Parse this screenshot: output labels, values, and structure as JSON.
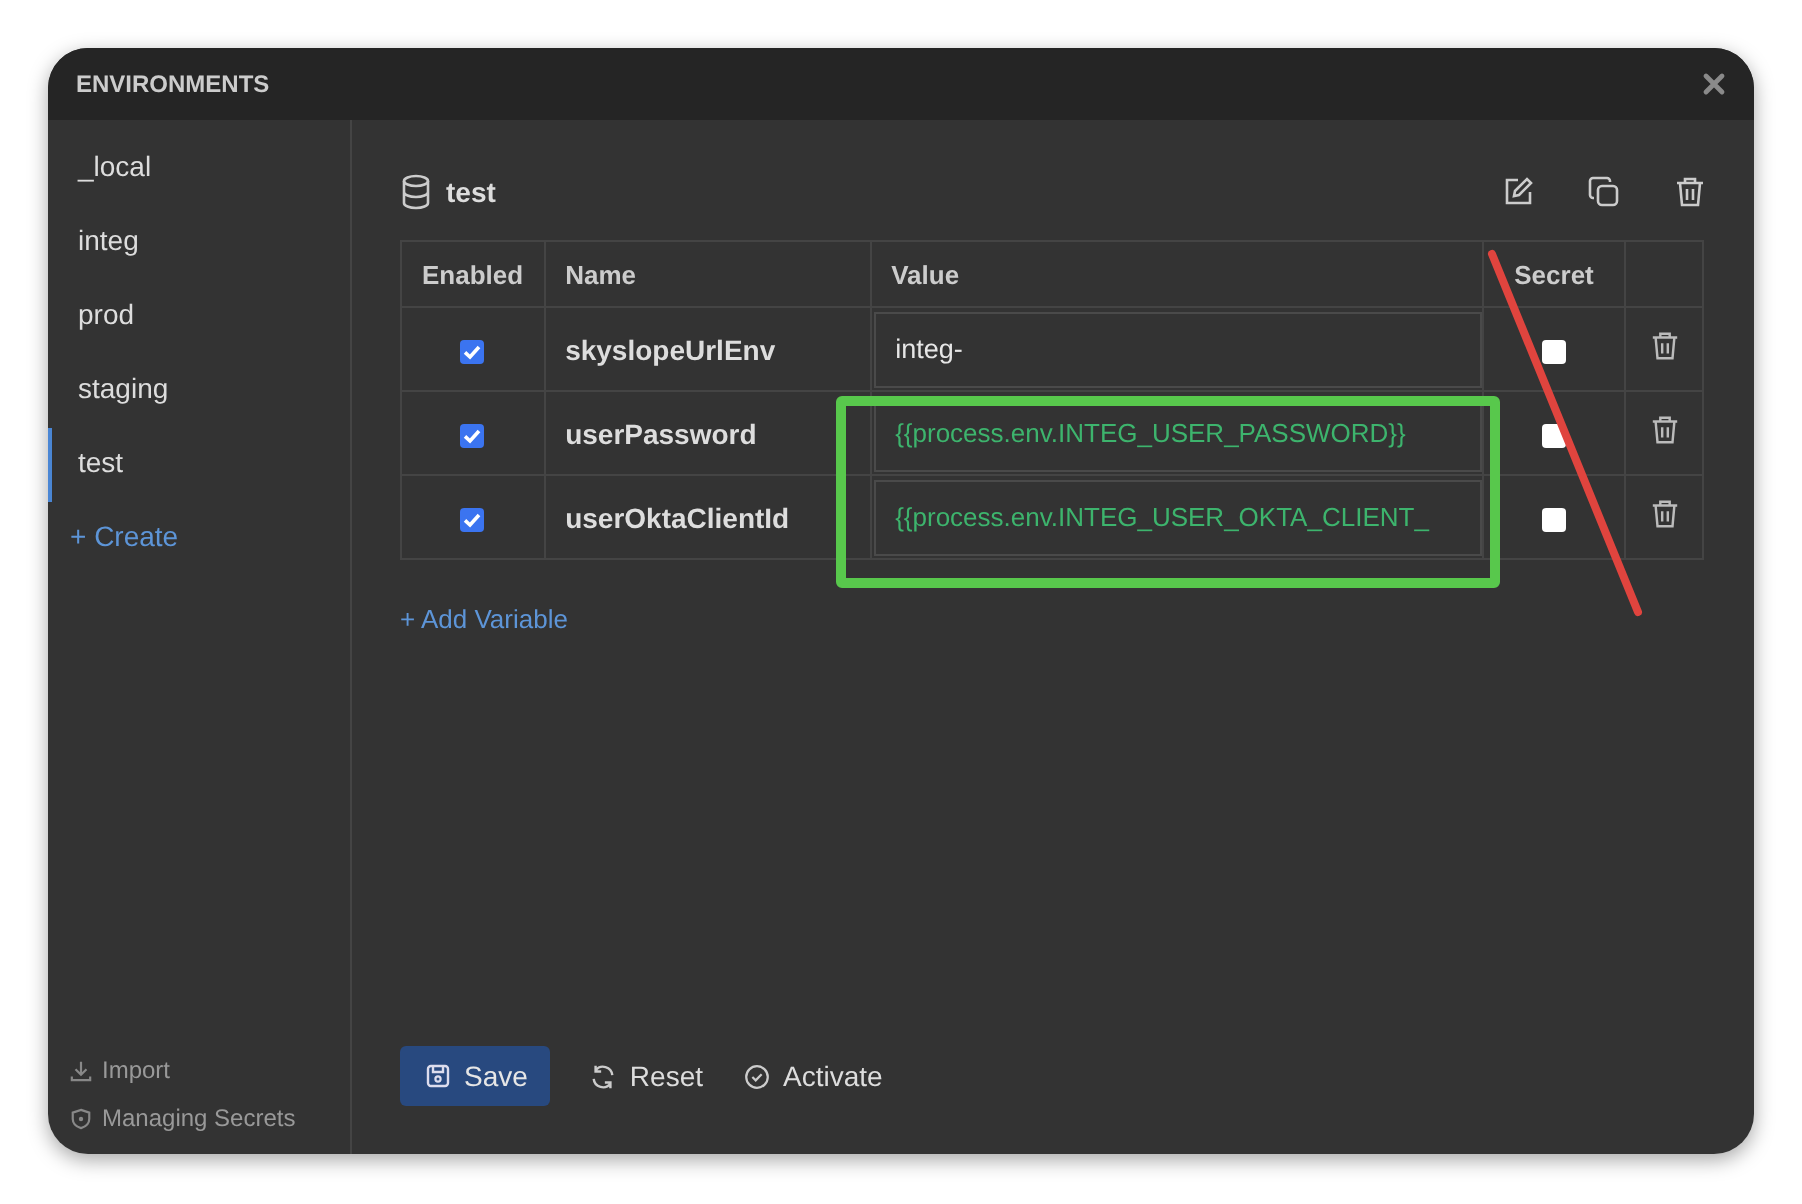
{
  "window": {
    "title": "ENVIRONMENTS"
  },
  "sidebar": {
    "items": [
      {
        "label": "_local",
        "selected": false
      },
      {
        "label": "integ",
        "selected": false
      },
      {
        "label": "prod",
        "selected": false
      },
      {
        "label": "staging",
        "selected": false
      },
      {
        "label": "test",
        "selected": true
      }
    ],
    "create": "+ Create",
    "import": "Import",
    "managing_secrets": "Managing Secrets"
  },
  "environment": {
    "name": "test"
  },
  "table": {
    "columns": [
      "Enabled",
      "Name",
      "Value",
      "Secret"
    ],
    "rows": [
      {
        "enabled": true,
        "name": "skyslopeUrlEnv",
        "value": "integ-",
        "kind": "plain",
        "secret": false
      },
      {
        "enabled": true,
        "name": "userPassword",
        "value": "{{process.env.INTEG_USER_PASSWORD}}",
        "kind": "reference",
        "secret": false
      },
      {
        "enabled": true,
        "name": "userOktaClientId",
        "value": "{{process.env.INTEG_USER_OKTA_CLIENT_",
        "kind": "reference",
        "secret": false
      }
    ]
  },
  "add_variable": "+ Add Variable",
  "buttons": {
    "save": "Save",
    "reset": "Reset",
    "activate": "Activate"
  }
}
